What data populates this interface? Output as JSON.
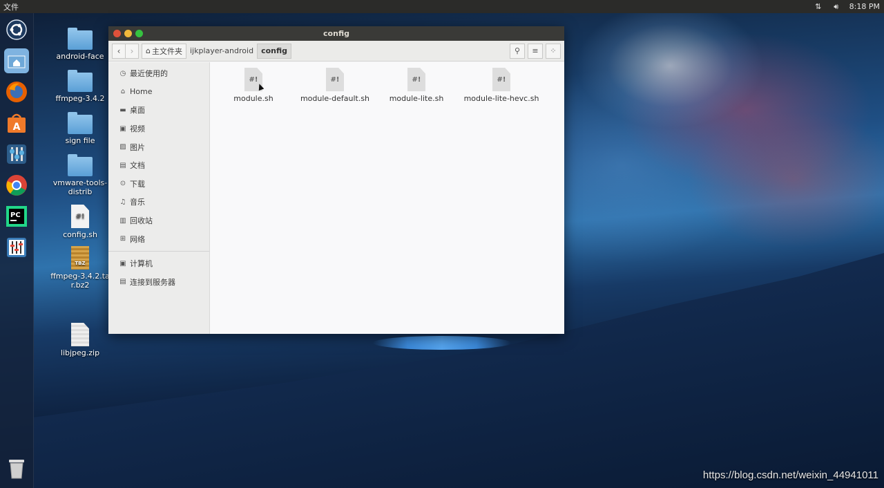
{
  "topbar": {
    "menu_label": "文件",
    "time": "8:18 PM",
    "network_icon": "network-icon",
    "volume_icon": "volume-icon"
  },
  "launcher": {
    "items": [
      {
        "name": "ubuntu-dash",
        "icon": "ubuntu-logo-icon"
      },
      {
        "name": "files",
        "icon": "home-folder-icon"
      },
      {
        "name": "firefox",
        "icon": "firefox-icon"
      },
      {
        "name": "software-center",
        "icon": "software-center-icon"
      },
      {
        "name": "system-settings",
        "icon": "settings-icon"
      },
      {
        "name": "chrome",
        "icon": "chrome-icon"
      },
      {
        "name": "pycharm",
        "icon": "pycharm-icon",
        "label": "PC"
      },
      {
        "name": "audio-mixer",
        "icon": "mixer-icon"
      },
      {
        "name": "trash",
        "icon": "trash-icon"
      }
    ]
  },
  "desktop": {
    "icons": [
      {
        "label": "android-face",
        "type": "folder"
      },
      {
        "label": "ffmpeg-3.4.2",
        "type": "folder"
      },
      {
        "label": "sign file",
        "type": "folder"
      },
      {
        "label": "vmware-tools-distrib",
        "type": "folder"
      },
      {
        "label": "config.sh",
        "type": "script",
        "glyph": "#!"
      },
      {
        "label": "ffmpeg-3.4.2.tar.bz2",
        "type": "archive",
        "glyph": "TBZ"
      },
      {
        "label": "libjpeg.zip",
        "type": "zip"
      }
    ]
  },
  "window": {
    "title": "config",
    "breadcrumbs": [
      "主文件夹",
      "ijkplayer-android",
      "config"
    ],
    "sidebar": {
      "items": [
        {
          "label": "最近使用的",
          "icon": "clock-icon",
          "glyph": "◷"
        },
        {
          "label": "Home",
          "icon": "home-icon",
          "glyph": "⌂"
        },
        {
          "label": "桌面",
          "icon": "desktop-icon",
          "glyph": "▬"
        },
        {
          "label": "视频",
          "icon": "video-icon",
          "glyph": "▣"
        },
        {
          "label": "图片",
          "icon": "image-icon",
          "glyph": "▨"
        },
        {
          "label": "文档",
          "icon": "document-icon",
          "glyph": "▤"
        },
        {
          "label": "下载",
          "icon": "download-icon",
          "glyph": "⊙"
        },
        {
          "label": "音乐",
          "icon": "music-icon",
          "glyph": "♫"
        },
        {
          "label": "回收站",
          "icon": "trash-icon",
          "glyph": "▥"
        },
        {
          "label": "网络",
          "icon": "network-icon",
          "glyph": "⊞"
        }
      ],
      "devices": [
        {
          "label": "计算机",
          "icon": "computer-icon",
          "glyph": "▣"
        },
        {
          "label": "连接到服务器",
          "icon": "server-icon",
          "glyph": "▤"
        }
      ]
    },
    "files": [
      {
        "name": "module.sh",
        "glyph": "#!"
      },
      {
        "name": "module-default.sh",
        "glyph": "#!"
      },
      {
        "name": "module-lite.sh",
        "glyph": "#!"
      },
      {
        "name": "module-lite-hevc.sh",
        "glyph": "#!"
      }
    ]
  },
  "watermark": "https://blog.csdn.net/weixin_44941011",
  "colors": {
    "close": "#e0513a",
    "minimize": "#f2b93b",
    "maximize": "#36c240"
  }
}
